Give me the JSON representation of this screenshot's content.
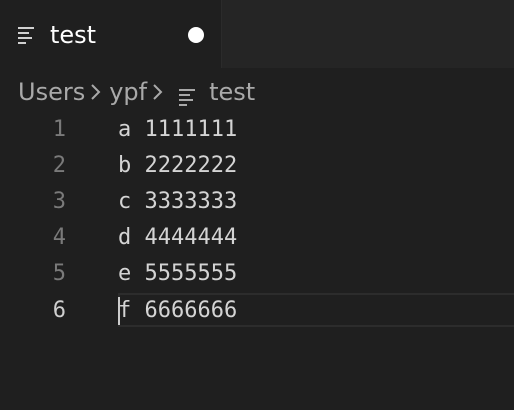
{
  "tab": {
    "title": "test",
    "icon": "file-lines-icon",
    "dirty": true
  },
  "breadcrumb": {
    "items": [
      "Users",
      "ypf",
      "test"
    ],
    "separator_icon": "chevron-right-icon",
    "file_icon": "file-lines-icon"
  },
  "editor": {
    "active_line": 6,
    "lines": [
      {
        "number": "1",
        "text": "a 1111111"
      },
      {
        "number": "2",
        "text": "b 2222222"
      },
      {
        "number": "3",
        "text": "c 3333333"
      },
      {
        "number": "4",
        "text": "d 4444444"
      },
      {
        "number": "5",
        "text": "e 5555555"
      },
      {
        "number": "6",
        "text": "f 6666666"
      }
    ]
  },
  "colors": {
    "background": "#1f1f1f",
    "tab_text": "#ffffff",
    "breadcrumb_text": "#a9a9a9",
    "line_number": "#7a7a7a",
    "active_line_number": "#cfcfcf",
    "code_text": "#d4d4d4"
  }
}
